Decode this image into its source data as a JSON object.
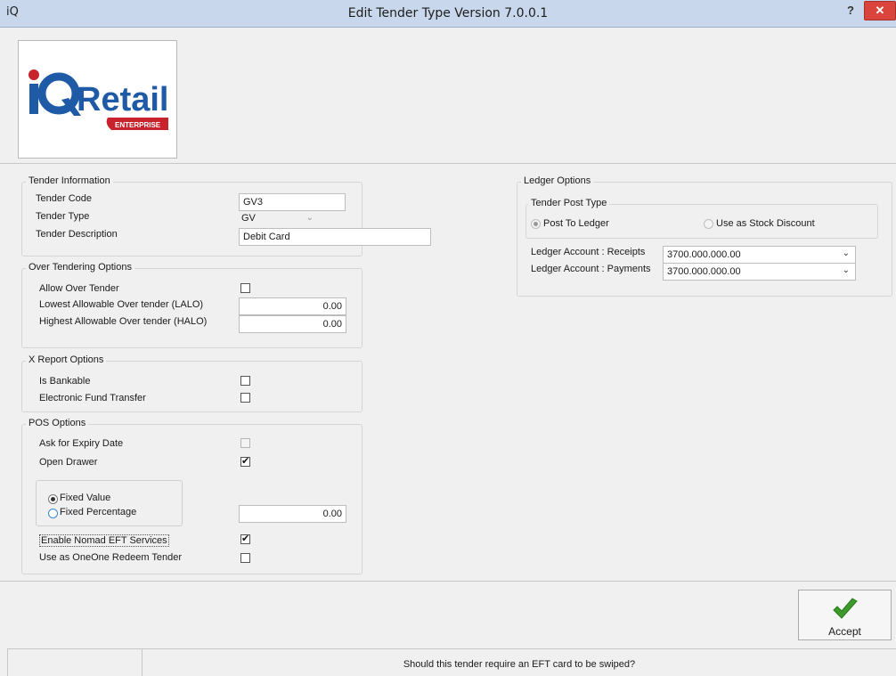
{
  "window": {
    "app_icon": "iQ",
    "title": "Edit Tender Type Version 7.0.0.1",
    "help_label": "?",
    "close_label": "✕"
  },
  "logo": {
    "brand_i": "i",
    "brand_q": "Q",
    "brand_name": "Retail",
    "brand_sub": "ENTERPRISE",
    "colors": {
      "blue": "#1f5aa6",
      "red": "#c8232c"
    }
  },
  "tender_info": {
    "legend": "Tender Information",
    "code_label": "Tender Code",
    "code_value": "GV3",
    "type_label": "Tender Type",
    "type_value": "GV",
    "description_label": "Tender  Description",
    "description_value": "Debit Card"
  },
  "over_tendering": {
    "legend": "Over Tendering Options",
    "allow_label": "Allow Over Tender",
    "allow_checked": false,
    "lalo_label": "Lowest Allowable Over tender (LALO)",
    "lalo_value": "0.00",
    "halo_label": "Highest Allowable Over tender (HALO)",
    "halo_value": "0.00"
  },
  "x_report": {
    "legend": "X Report Options",
    "bankable_label": "Is Bankable",
    "bankable_checked": false,
    "eft_label": "Electronic Fund Transfer",
    "eft_checked": false
  },
  "pos_options": {
    "legend": "POS Options",
    "expiry_label": "Ask for Expiry Date",
    "expiry_checked": false,
    "drawer_label": "Open Drawer",
    "drawer_checked": true,
    "fixed_value_label": "Fixed Value",
    "fixed_percentage_label": "Fixed Percentage",
    "selected_mode": "Fixed Value",
    "amount_value": "0.00",
    "nomad_label": "Enable Nomad EFT Services",
    "nomad_checked": true,
    "oneone_label": "Use as OneOne Redeem Tender",
    "oneone_checked": false
  },
  "ledger": {
    "legend": "Ledger Options",
    "post_type_legend": "Tender Post Type",
    "post_to_ledger_label": "Post To Ledger",
    "stock_discount_label": "Use as Stock Discount",
    "selected_post_type": "Post To Ledger",
    "receipts_label": "Ledger Account : Receipts",
    "receipts_value": "3700.000.000.00",
    "payments_label": "Ledger Account : Payments",
    "payments_value": "3700.000.000.00"
  },
  "footer": {
    "accept_label": "Accept",
    "accept_icon_color": "#3b9a2a",
    "status_text": "Should this tender require an EFT card to be swiped?"
  }
}
